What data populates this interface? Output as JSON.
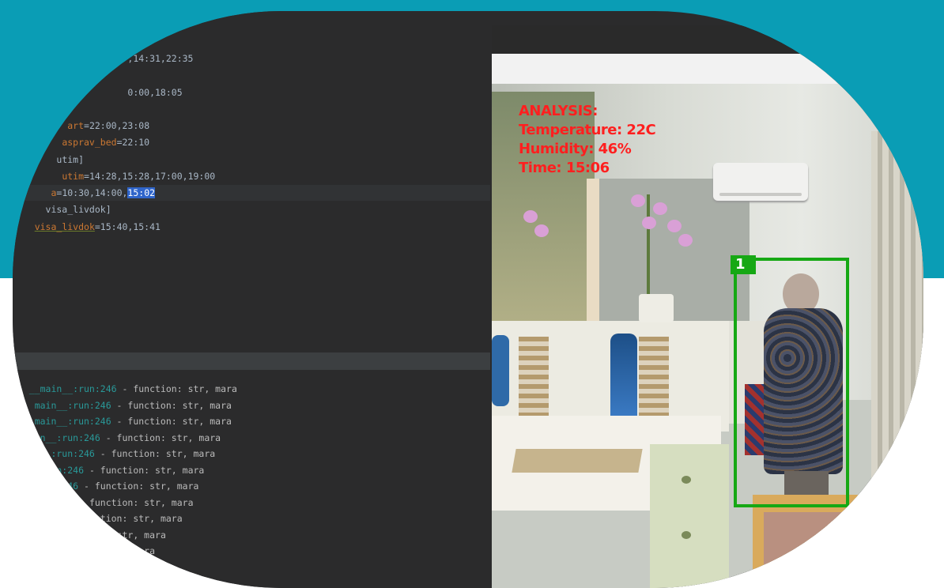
{
  "editor": {
    "lines": [
      {
        "segments": [
          {
            "text": "                     ,14:31,22:35",
            "cls": ""
          }
        ]
      },
      {
        "segments": [
          {
            "text": "",
            "cls": ""
          }
        ]
      },
      {
        "segments": [
          {
            "text": "                     0:00,18:05",
            "cls": ""
          }
        ]
      },
      {
        "segments": [
          {
            "text": "",
            "cls": ""
          }
        ]
      },
      {
        "segments": [
          {
            "text": "          ",
            "cls": ""
          },
          {
            "text": "art",
            "cls": "k"
          },
          {
            "text": "=22:00,23:08",
            "cls": ""
          }
        ]
      },
      {
        "segments": [
          {
            "text": "         ",
            "cls": ""
          },
          {
            "text": "asprav_bed",
            "cls": "k"
          },
          {
            "text": "=22:10",
            "cls": ""
          }
        ]
      },
      {
        "segments": [
          {
            "text": "        ",
            "cls": ""
          },
          {
            "text": "utim]",
            "cls": ""
          }
        ]
      },
      {
        "segments": [
          {
            "text": "         ",
            "cls": ""
          },
          {
            "text": "utim",
            "cls": "k"
          },
          {
            "text": "=14:28,15:28,17:00,19:00",
            "cls": ""
          }
        ]
      },
      {
        "segments": [
          {
            "text": "       ",
            "cls": ""
          },
          {
            "text": "a",
            "cls": "k"
          },
          {
            "text": "=10:30,14:00,",
            "cls": ""
          },
          {
            "text": "15:02",
            "cls": "sel"
          }
        ],
        "highlight": true
      },
      {
        "segments": [
          {
            "text": "      visa_livdok]",
            "cls": ""
          }
        ]
      },
      {
        "segments": [
          {
            "text": "    ",
            "cls": ""
          },
          {
            "text": "visa_livdok",
            "cls": "k ul"
          },
          {
            "text": "=15:40,15:41",
            "cls": ""
          }
        ]
      }
    ]
  },
  "console": {
    "lines": [
      {
        "loc": "   __main__:run:246",
        "msg": " - function: str, mara"
      },
      {
        "loc": "    main__:run:246",
        "msg": " - function: str, mara"
      },
      {
        "loc": "    main__:run:246",
        "msg": " - function: str, mara"
      },
      {
        "loc": "    in__:run:246",
        "msg": " - function: str, mara"
      },
      {
        "loc": "     __:run:246",
        "msg": " - function: str, mara"
      },
      {
        "loc": "      run:246",
        "msg": " - function: str, mara"
      },
      {
        "loc": "       n:246",
        "msg": " - function: str, mara"
      },
      {
        "loc": "         46",
        "msg": " - function: str, mara"
      },
      {
        "loc": "            ",
        "msg": "function: str, mara"
      },
      {
        "loc": "             ",
        "msg": "tion: str, mara"
      },
      {
        "loc": "                 ",
        "msg": "     mara"
      }
    ]
  },
  "camera": {
    "overlay_lines": [
      "ANALYSIS:",
      "Temperature: 22C",
      "Humidity: 46%",
      "Time: 15:06"
    ],
    "detection_label": "1",
    "overlay_color": "#ff1f1f",
    "box_color": "#16a814"
  },
  "colors": {
    "teal_background": "#0a9db5",
    "editor_background": "#2b2b2c",
    "keyword": "#cc7832",
    "selection": "#2f65ca",
    "console_location": "#299999"
  }
}
